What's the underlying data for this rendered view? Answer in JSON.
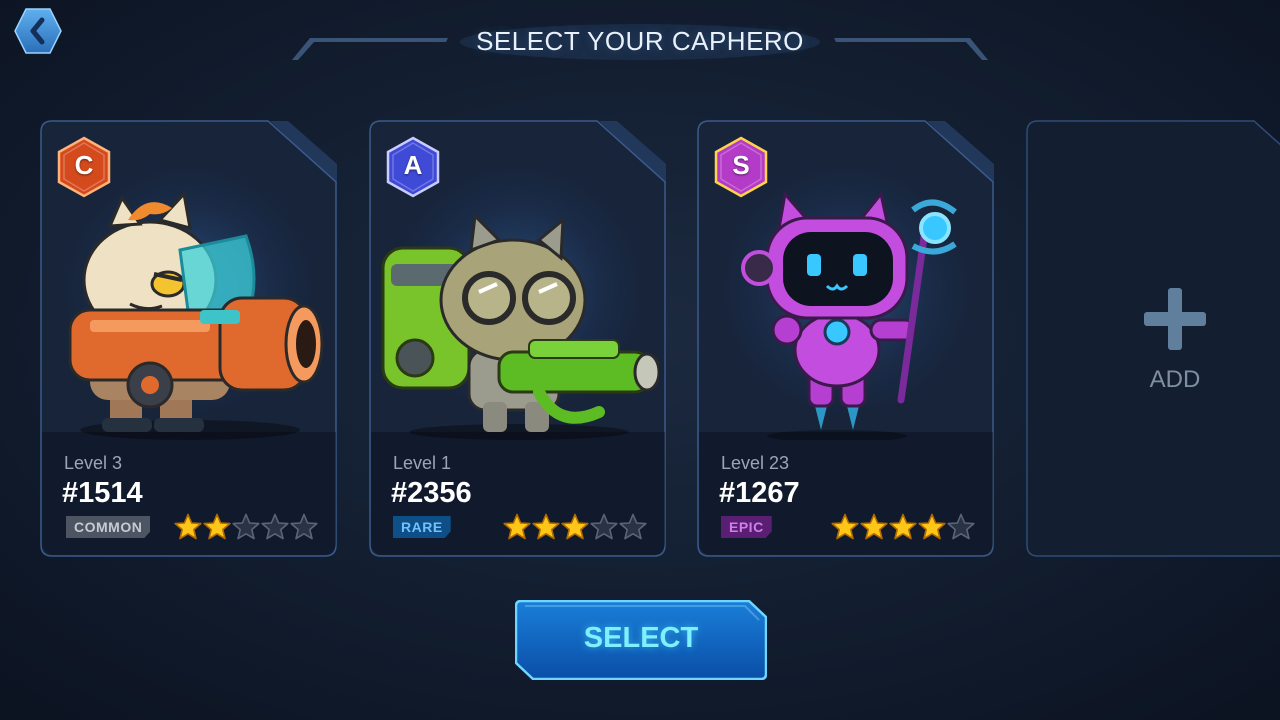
{
  "header": {
    "title": "SELECT YOUR CAPHERO",
    "back_icon": "chevron-left-icon"
  },
  "cards": [
    {
      "tier": "C",
      "level_text": "Level 3",
      "id_text": "#1514",
      "rarity": "COMMON",
      "stars_filled": 2,
      "stars_total": 5,
      "tier_color": "#d44a1c",
      "rarity_bg": "#4c5561",
      "rarity_fg": "#c6ccd4",
      "hero_icon": "armored-cat-cannon-hero-icon"
    },
    {
      "tier": "A",
      "level_text": "Level 1",
      "id_text": "#2356",
      "rarity": "RARE",
      "stars_filled": 3,
      "stars_total": 5,
      "tier_color": "#3f4bd6",
      "rarity_bg": "#0d4f86",
      "rarity_fg": "#6fc2ff",
      "hero_icon": "gasmask-cat-blaster-hero-icon"
    },
    {
      "tier": "S",
      "level_text": "Level 23",
      "id_text": "#1267",
      "rarity": "EPIC",
      "stars_filled": 4,
      "stars_total": 5,
      "tier_color": "#b43bc8",
      "rarity_bg": "#5a1f72",
      "rarity_fg": "#d17df0",
      "hero_icon": "robot-cat-staff-hero-icon"
    }
  ],
  "add_card": {
    "label": "ADD",
    "icon": "plus-icon"
  },
  "select_button": {
    "label": "SELECT"
  },
  "colors": {
    "background": "#142033",
    "card_border": "#3a5b8c",
    "star_filled": "#ffc61a",
    "star_empty": "#2a3344",
    "accent_cyan": "#7ef0ff"
  }
}
